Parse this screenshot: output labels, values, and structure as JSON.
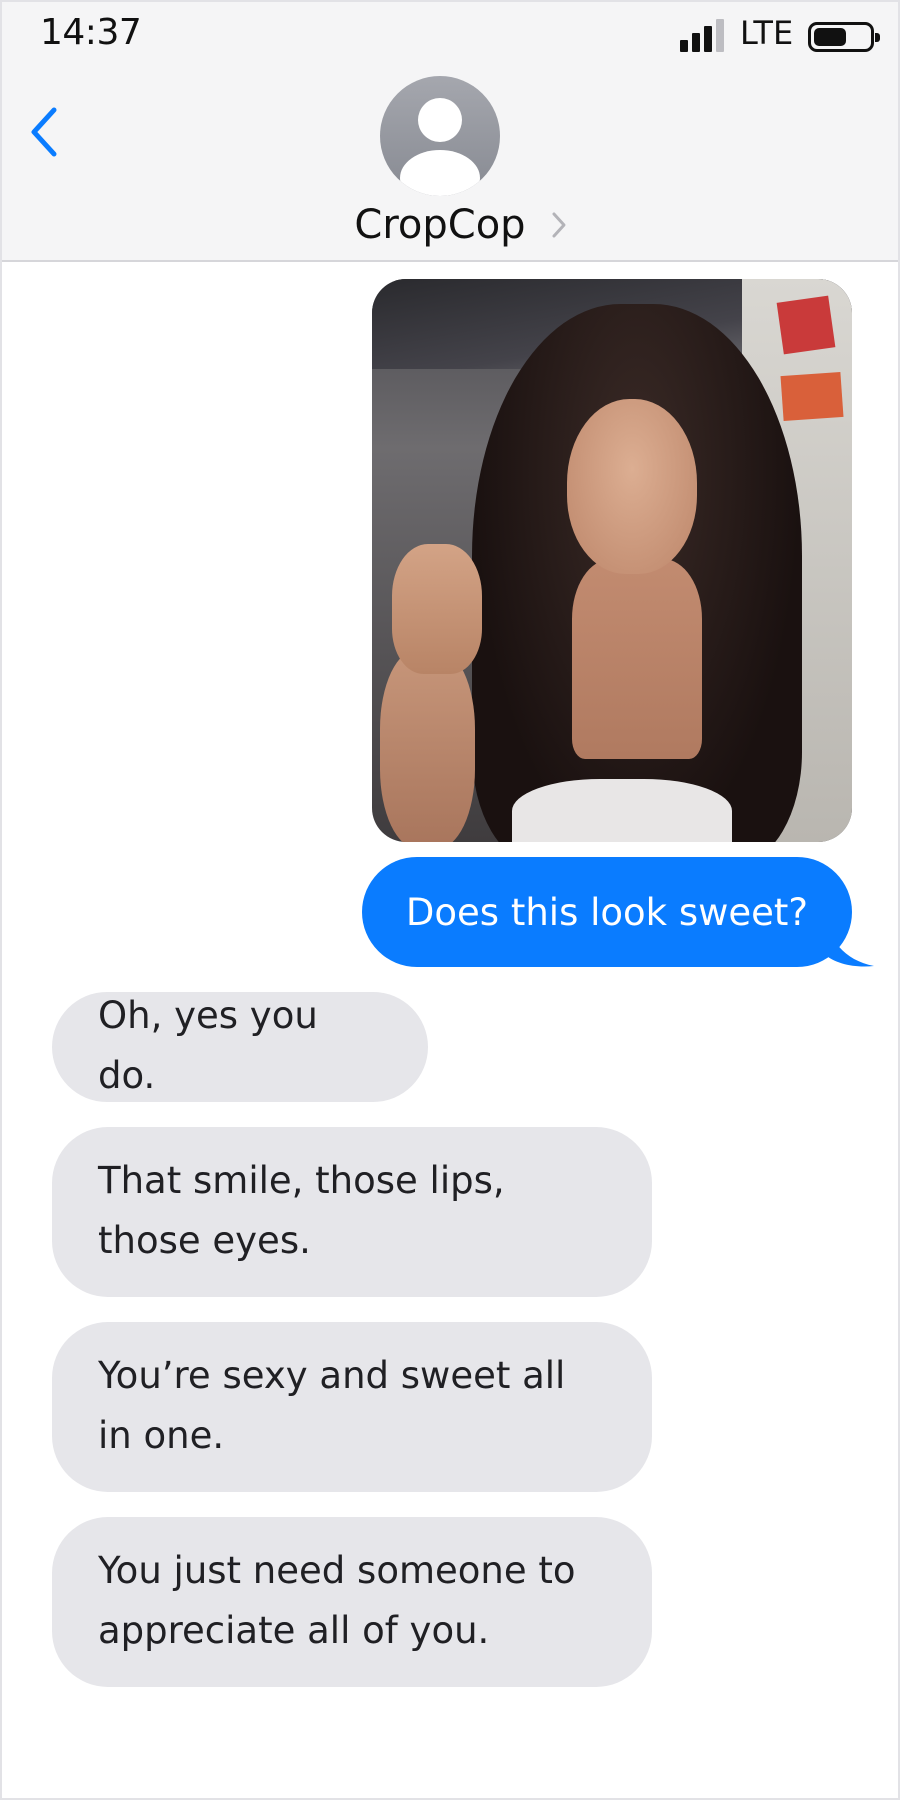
{
  "status_bar": {
    "time": "14:37",
    "network": "LTE",
    "signal_bars_lit": 3,
    "signal_bars_total": 4,
    "battery_level": 0.6
  },
  "conversation": {
    "contact_name": "CropCop",
    "back_icon": "chevron-left-icon",
    "avatar_icon": "person-silhouette-icon",
    "details_icon": "chevron-right-icon",
    "accent_color": "#0a7cff",
    "incoming_bubble_color": "#e6e6ea"
  },
  "messages": [
    {
      "type": "image",
      "direction": "outgoing",
      "alt": "photo"
    },
    {
      "type": "text",
      "direction": "outgoing",
      "text": "Does this look sweet?"
    },
    {
      "type": "text",
      "direction": "incoming",
      "text": "Oh, yes you do."
    },
    {
      "type": "text",
      "direction": "incoming",
      "text": "That smile, those lips, those eyes."
    },
    {
      "type": "text",
      "direction": "incoming",
      "text": "You’re sexy and sweet all in one."
    },
    {
      "type": "text",
      "direction": "incoming",
      "text": "You just need someone to appreciate all of you."
    }
  ]
}
